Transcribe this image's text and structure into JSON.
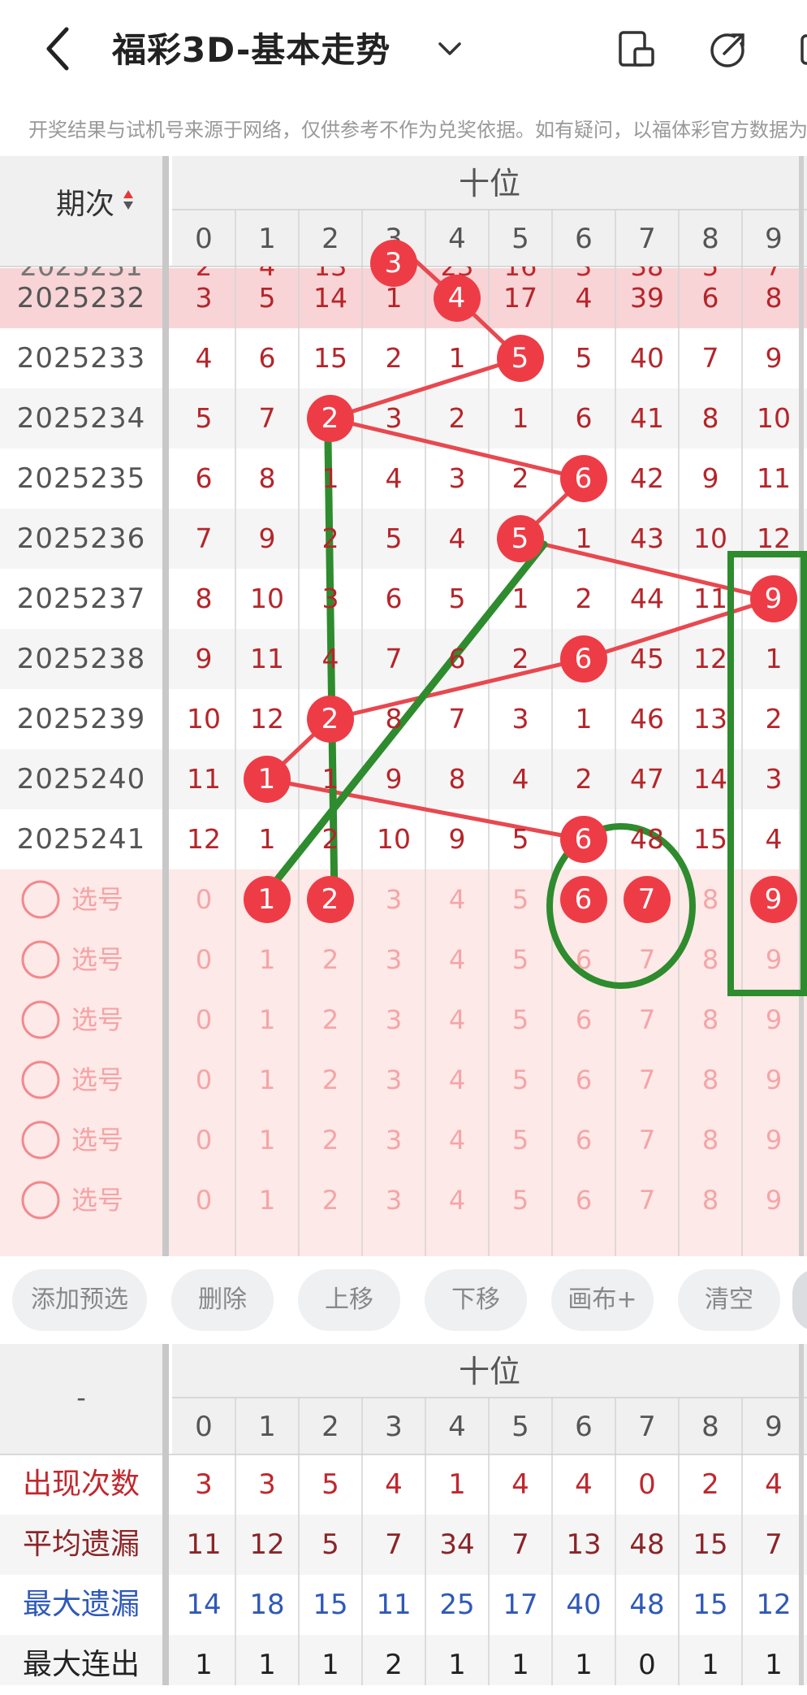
{
  "header": {
    "title": "福彩3D-基本走势",
    "notice": "开奖结果与试机号来源于网络，仅供参考不作为兑奖依据。如有疑问，以福体彩官方数据为准"
  },
  "table": {
    "period_header": "期次",
    "position_header": "十位",
    "digits": [
      "0",
      "1",
      "2",
      "3",
      "4",
      "5",
      "6",
      "7",
      "8",
      "9"
    ],
    "partial_row": {
      "label": "2025231",
      "values": [
        "2",
        "4",
        "13",
        "3",
        "23",
        "16",
        "3",
        "38",
        "5",
        "7"
      ]
    },
    "rows": [
      {
        "period": "2025232",
        "values": [
          "3",
          "5",
          "14",
          "1",
          "4",
          "17",
          "4",
          "39",
          "6",
          "8"
        ],
        "hit": 4
      },
      {
        "period": "2025233",
        "values": [
          "4",
          "6",
          "15",
          "2",
          "1",
          "5",
          "5",
          "40",
          "7",
          "9"
        ],
        "hit": 5
      },
      {
        "period": "2025234",
        "values": [
          "5",
          "7",
          "2",
          "3",
          "2",
          "1",
          "6",
          "41",
          "8",
          "10"
        ],
        "hit": 2
      },
      {
        "period": "2025235",
        "values": [
          "6",
          "8",
          "1",
          "4",
          "3",
          "2",
          "6",
          "42",
          "9",
          "11"
        ],
        "hit": 6
      },
      {
        "period": "2025236",
        "values": [
          "7",
          "9",
          "2",
          "5",
          "4",
          "5",
          "1",
          "43",
          "10",
          "12"
        ],
        "hit": 5
      },
      {
        "period": "2025237",
        "values": [
          "8",
          "10",
          "3",
          "6",
          "5",
          "1",
          "2",
          "44",
          "11",
          "9"
        ],
        "hit": 9
      },
      {
        "period": "2025238",
        "values": [
          "9",
          "11",
          "4",
          "7",
          "6",
          "2",
          "6",
          "45",
          "12",
          "1"
        ],
        "hit": 6
      },
      {
        "period": "2025239",
        "values": [
          "10",
          "12",
          "2",
          "8",
          "7",
          "3",
          "1",
          "46",
          "13",
          "2"
        ],
        "hit": 2
      },
      {
        "period": "2025240",
        "values": [
          "11",
          "1",
          "1",
          "9",
          "8",
          "4",
          "2",
          "47",
          "14",
          "3"
        ],
        "hit": 1
      },
      {
        "period": "2025241",
        "values": [
          "12",
          "1",
          "2",
          "10",
          "9",
          "5",
          "6",
          "48",
          "15",
          "4"
        ],
        "hit": 6
      }
    ],
    "select_label": "选号",
    "select_rows": [
      {
        "selected": [
          1,
          2,
          6,
          7,
          9
        ]
      },
      {
        "selected": []
      },
      {
        "selected": []
      },
      {
        "selected": []
      },
      {
        "selected": []
      },
      {
        "selected": []
      }
    ]
  },
  "buttons": [
    "添加预选",
    "删除",
    "上移",
    "下移",
    "画布+",
    "清空"
  ],
  "stats": {
    "corner": "-",
    "position_header": "十位",
    "rows": [
      {
        "label": "出现次数",
        "values": [
          "3",
          "3",
          "5",
          "4",
          "1",
          "4",
          "4",
          "0",
          "2",
          "4"
        ],
        "color": "#c0272d"
      },
      {
        "label": "平均遗漏",
        "values": [
          "11",
          "12",
          "5",
          "7",
          "34",
          "7",
          "13",
          "48",
          "15",
          "7"
        ],
        "color": "#8b2528"
      },
      {
        "label": "最大遗漏",
        "values": [
          "14",
          "18",
          "15",
          "11",
          "25",
          "17",
          "40",
          "48",
          "15",
          "12"
        ],
        "color": "#2f59b7"
      },
      {
        "label": "最大连出",
        "values": [
          "1",
          "1",
          "1",
          "2",
          "1",
          "1",
          "1",
          "0",
          "1",
          "1"
        ],
        "color": "#222222"
      }
    ]
  },
  "colors": {
    "accent": "#ee3c46",
    "annotation": "#2e8b2e",
    "hit_row_bg": "#f8d4d6",
    "select_bg": "#fde9e7"
  }
}
